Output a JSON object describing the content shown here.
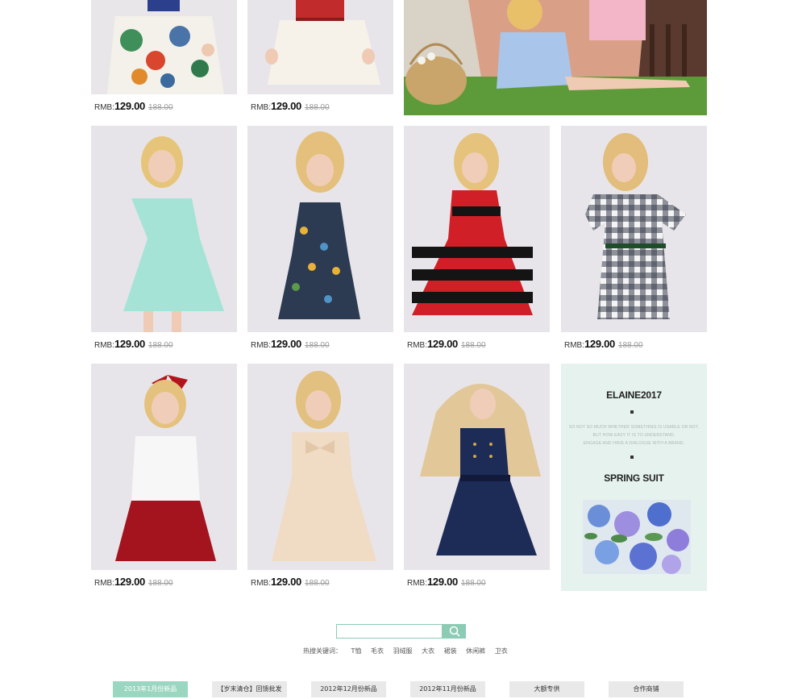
{
  "products": [
    {
      "name": "floral-dress",
      "currency": "RMB:",
      "price": "129.00",
      "original_price": "188.00"
    },
    {
      "name": "tulle-dress",
      "currency": "RMB:",
      "price": "129.00",
      "original_price": "188.00"
    },
    {
      "name": "mint-dress",
      "currency": "RMB:",
      "price": "129.00",
      "original_price": "188.00"
    },
    {
      "name": "print-sundress",
      "currency": "RMB:",
      "price": "129.00",
      "original_price": "188.00"
    },
    {
      "name": "striped-dress",
      "currency": "RMB:",
      "price": "129.00",
      "original_price": "188.00"
    },
    {
      "name": "gingham-dress",
      "currency": "RMB:",
      "price": "129.00",
      "original_price": "188.00"
    },
    {
      "name": "tutu-outfit",
      "currency": "RMB:",
      "price": "129.00",
      "original_price": "188.00"
    },
    {
      "name": "beige-bow-dress",
      "currency": "RMB:",
      "price": "129.00",
      "original_price": "188.00"
    },
    {
      "name": "navy-dress",
      "currency": "RMB:",
      "price": "129.00",
      "original_price": "188.00"
    }
  ],
  "promo": {
    "title": "ELAINE2017",
    "text_line1": "SO NOT SO MUCH WHETHER SOMETHING IS USABLE OR NOT,",
    "text_line2": "BUT HOW EASY IT IS TO UNDERSTAND.",
    "text_line3": "ENGAGE AND HAVE A DIALOGUE WITH A BRAND.",
    "subtitle": "SPRING SUIT"
  },
  "search": {
    "placeholder": "",
    "hot_label": "热搜关键词：",
    "keywords": [
      "T恤",
      "毛衣",
      "羽绒服",
      "大衣",
      "裙装",
      "休闲裤",
      "卫衣"
    ]
  },
  "bottom_nav": [
    "2013年1月份新品",
    "【岁末清仓】回馈批发",
    "2012年12月份新品",
    "2012年11月份新品",
    "大额专供",
    "合作商铺"
  ],
  "colors": {
    "accent": "#8ccbb4",
    "active_tab": "#9bd6c0",
    "promo_bg": "#e6f2ee"
  }
}
